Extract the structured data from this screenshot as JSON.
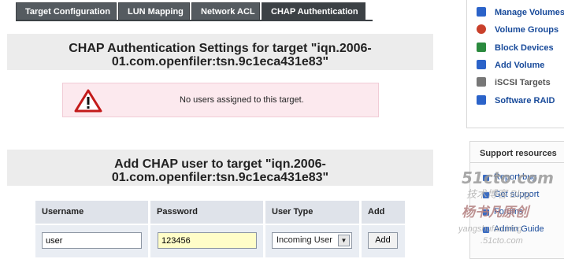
{
  "tabs": [
    {
      "label": "Target Configuration",
      "active": false
    },
    {
      "label": "LUN Mapping",
      "active": false
    },
    {
      "label": "Network ACL",
      "active": false
    },
    {
      "label": "CHAP Authentication",
      "active": true
    }
  ],
  "chap_settings": {
    "title_line1": "CHAP Authentication Settings for target \"iqn.2006-",
    "title_line2": "01.com.openfiler:tsn.9c1eca431e83\"",
    "warning_icon": "warning-triangle-icon",
    "warning_text": "No users assigned to this target."
  },
  "add_user": {
    "title_line1": "Add CHAP user to target \"iqn.2006-",
    "title_line2": "01.com.openfiler:tsn.9c1eca431e83\"",
    "columns": [
      "Username",
      "Password",
      "User Type",
      "Add"
    ],
    "username_value": "user",
    "password_value": "123456",
    "user_type_selected": "Incoming User",
    "add_button": "Add"
  },
  "sidebar": {
    "nav_items": [
      {
        "label": "Manage Volumes",
        "icon": "volumes-icon",
        "color": "#2b63c9"
      },
      {
        "label": "Volume Groups",
        "icon": "volume-groups-icon",
        "color": "#c9402b"
      },
      {
        "label": "Block Devices",
        "icon": "block-devices-icon",
        "color": "#2b8a3e"
      },
      {
        "label": "Add Volume",
        "icon": "add-volume-icon",
        "color": "#2b63c9"
      },
      {
        "label": "iSCSI Targets",
        "icon": "iscsi-targets-icon",
        "color": "#777777"
      },
      {
        "label": "Software RAID",
        "icon": "software-raid-icon",
        "color": "#2b63c9"
      }
    ],
    "support_title": "Support resources",
    "support_items": [
      "Report bug",
      "Get support",
      "Forums",
      "Admin Guide"
    ]
  },
  "watermark": {
    "line1": "51cto.com",
    "line2": "技术博客  Blog",
    "line3": "杨书凡原创",
    "line4": "yangshufan.blog",
    "line5": ".51cto.com"
  }
}
